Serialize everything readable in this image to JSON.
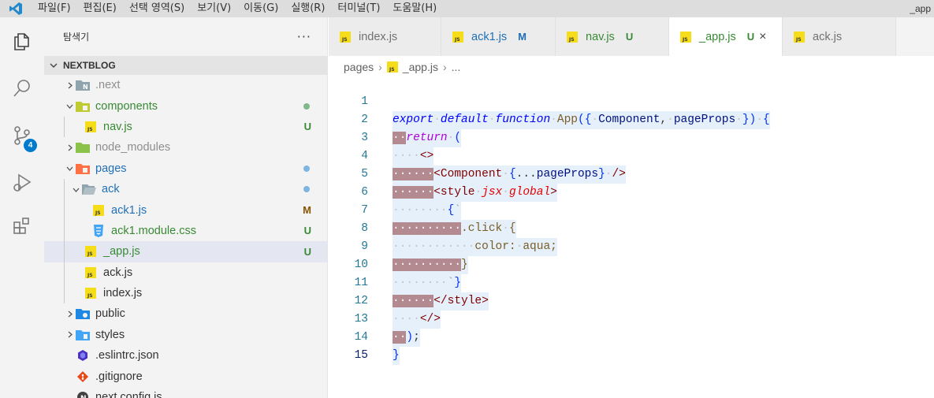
{
  "title_bar": {
    "menus": [
      "파일(F)",
      "편집(E)",
      "선택 영역(S)",
      "보기(V)",
      "이동(G)",
      "실행(R)",
      "터미널(T)",
      "도움말(H)"
    ],
    "window_title_fragment": "_app"
  },
  "activity_bar": {
    "icons": [
      "files-icon",
      "search-icon",
      "source-control-icon",
      "run-debug-icon",
      "extensions-icon"
    ],
    "source_control_badge": "4",
    "accent_color": "#007acc"
  },
  "sidebar": {
    "title": "탐색기",
    "more": "···",
    "section": "NEXTBLOG",
    "items": [
      {
        "label": ".next",
        "decoration": "",
        "color": "#8e8e8e"
      },
      {
        "label": "components",
        "decoration": "",
        "color": "#388a34"
      },
      {
        "label": "nav.js",
        "decoration": "U",
        "color": "#388a34"
      },
      {
        "label": "node_modules",
        "decoration": "",
        "color": "#8e8e8e"
      },
      {
        "label": "pages",
        "decoration": "",
        "color": "#1f6fb6"
      },
      {
        "label": "ack",
        "decoration": "",
        "color": "#1f6fb6"
      },
      {
        "label": "ack1.js",
        "decoration": "M",
        "color": "#1f6fb6"
      },
      {
        "label": "ack1.module.css",
        "decoration": "U",
        "color": "#388a34"
      },
      {
        "label": "_app.js",
        "decoration": "U",
        "color": "#388a34"
      },
      {
        "label": "ack.js",
        "decoration": "",
        "color": "#333333"
      },
      {
        "label": "index.js",
        "decoration": "",
        "color": "#333333"
      },
      {
        "label": "public",
        "decoration": "",
        "color": "#333333"
      },
      {
        "label": "styles",
        "decoration": "",
        "color": "#333333"
      },
      {
        "label": ".eslintrc.json",
        "decoration": "",
        "color": "#333333"
      },
      {
        "label": ".gitignore",
        "decoration": "",
        "color": "#333333"
      },
      {
        "label": "next.config.js",
        "decoration": "",
        "color": "#333333"
      }
    ]
  },
  "tabs": [
    {
      "label": "index.js",
      "decoration": "",
      "active": false
    },
    {
      "label": "ack1.js",
      "decoration": "M",
      "active": false
    },
    {
      "label": "nav.js",
      "decoration": "U",
      "active": false
    },
    {
      "label": "_app.js",
      "decoration": "U",
      "active": true,
      "close": "×"
    },
    {
      "label": "ack.js",
      "decoration": "",
      "active": false
    }
  ],
  "breadcrumb": {
    "folder": "pages",
    "sep": "›",
    "file": "_app.js",
    "more": "..."
  },
  "code": {
    "line_numbers": [
      "1",
      "2",
      "3",
      "4",
      "5",
      "6",
      "7",
      "8",
      "9",
      "10",
      "11",
      "12",
      "13",
      "14",
      "15"
    ],
    "lines": [
      "export default function App({ Component, pageProps }) {",
      "  return (",
      "    <>",
      "      <Component {...pageProps} />",
      "      <style jsx global>",
      "        {`",
      "          .click {",
      "            color: aqua;",
      "          }",
      "        `}",
      "      </style>",
      "    </>",
      "  );",
      "}",
      ""
    ]
  }
}
